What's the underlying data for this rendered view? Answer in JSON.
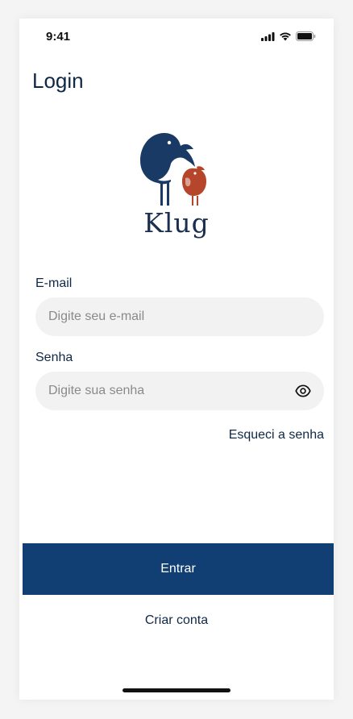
{
  "status_bar": {
    "time": "9:41",
    "icons": [
      "signal-icon",
      "wifi-icon",
      "battery-icon"
    ]
  },
  "header": {
    "title": "Login"
  },
  "logo": {
    "brand_name": "Klug",
    "colors": {
      "big_bird": "#1a3a66",
      "small_bird": "#b5452b"
    }
  },
  "form": {
    "email": {
      "label": "E-mail",
      "placeholder": "Digite seu e-mail",
      "value": ""
    },
    "password": {
      "label": "Senha",
      "placeholder": "Digite sua senha",
      "value": "",
      "toggle_icon": "eye-icon"
    },
    "forgot_label": "Esqueci a senha"
  },
  "actions": {
    "primary_label": "Entrar",
    "secondary_label": "Criar conta"
  },
  "colors": {
    "primary": "#123f73",
    "text": "#0f2846",
    "input_bg": "#f2f2f2"
  }
}
